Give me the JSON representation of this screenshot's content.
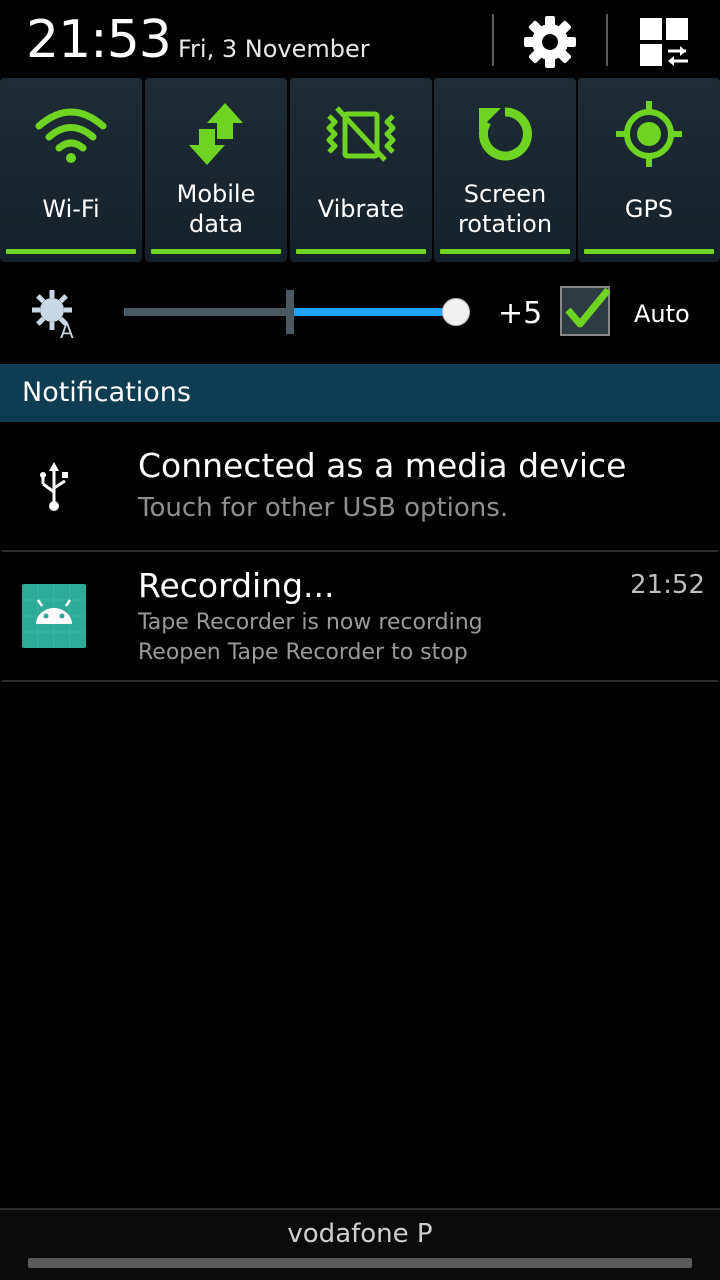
{
  "status": {
    "time": "21:53",
    "date": "Fri, 3 November"
  },
  "header_icons": [
    "gear-icon",
    "quick-panel-grid-icon"
  ],
  "toggles": [
    {
      "label": "Wi-Fi",
      "icon": "wifi-icon",
      "active": true
    },
    {
      "label": "Mobile data",
      "icon": "mobile-data-icon",
      "active": true
    },
    {
      "label": "Vibrate",
      "icon": "vibrate-icon",
      "active": true
    },
    {
      "label": "Screen rotation",
      "icon": "screen-rotation-icon",
      "active": true
    },
    {
      "label": "GPS",
      "icon": "gps-icon",
      "active": true
    }
  ],
  "brightness": {
    "icon": "auto-brightness-icon",
    "value": "+5",
    "auto_label": "Auto",
    "auto_checked": true
  },
  "notifications": {
    "header": "Notifications",
    "items": [
      {
        "icon": "usb-icon",
        "title": "Connected as a media device",
        "subtitle": "Touch for other USB options."
      },
      {
        "icon": "android-app-icon",
        "title": "Recording...",
        "time": "21:52",
        "line1": "Tape Recorder is now recording",
        "line2": "Reopen Tape Recorder to stop"
      }
    ]
  },
  "carrier": "vodafone P",
  "colors": {
    "accent_green": "#6fd421",
    "slider_blue": "#1ea0ff",
    "header_teal": "#0e3c52",
    "app_icon_bg": "#2eaa98"
  }
}
